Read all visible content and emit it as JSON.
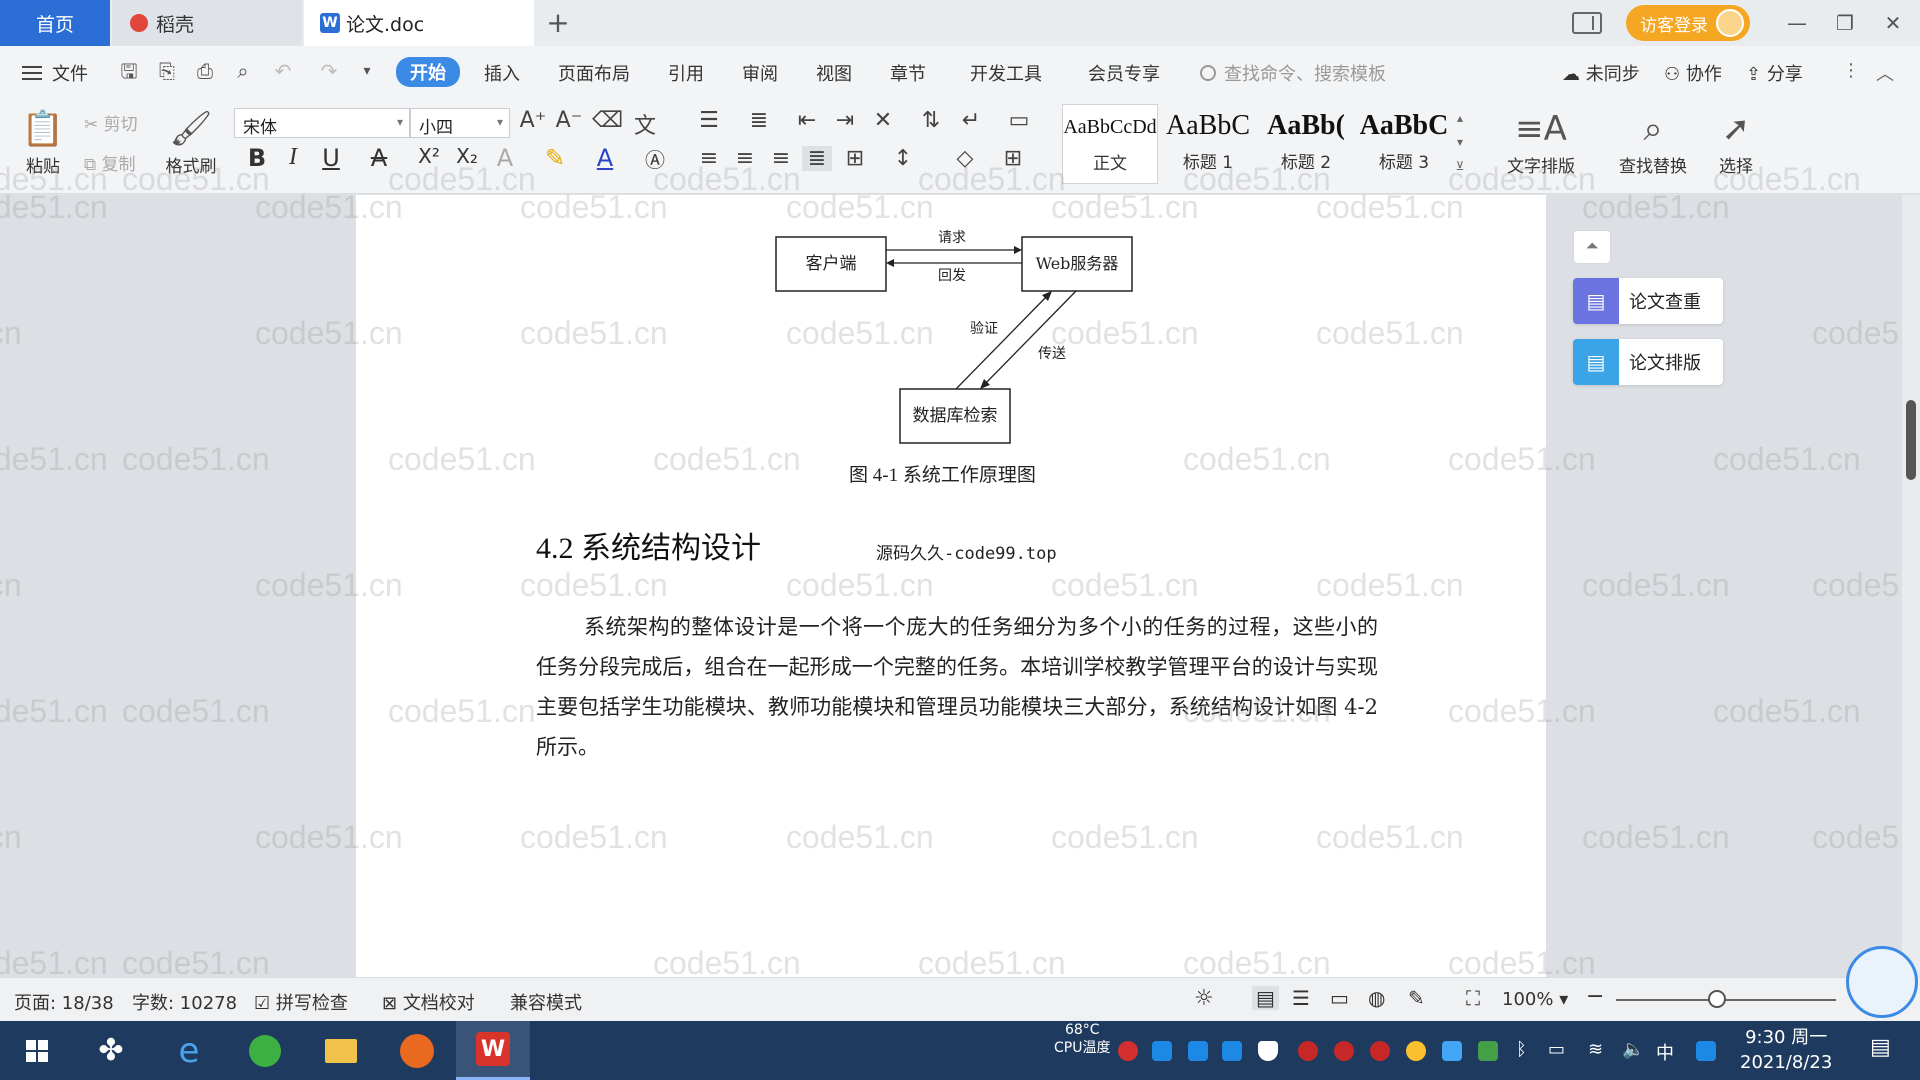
{
  "tabs": {
    "home": "首页",
    "daoke": "稻壳",
    "doc": "论文.doc",
    "add": "+",
    "close": "✕"
  },
  "titlebar": {
    "guest_login": "访客登录"
  },
  "menu": {
    "file": "文件",
    "start": "开始",
    "insert": "插入",
    "page_layout": "页面布局",
    "reference": "引用",
    "review": "审阅",
    "view": "视图",
    "chapter": "章节",
    "dev_tools": "开发工具",
    "member": "会员专享",
    "search_placeholder": "查找命令、搜索模板",
    "unsynced": "未同步",
    "collab": "协作",
    "share": "分享"
  },
  "ribbon": {
    "paste": "粘贴",
    "cut": "剪切",
    "copy": "复制",
    "format_painter": "格式刷",
    "font": "宋体",
    "size": "小四",
    "styles": [
      {
        "preview": "AaBbCcDd",
        "label": "正文"
      },
      {
        "preview": "AaBbC",
        "label": "标题 1"
      },
      {
        "preview": "AaBb(",
        "label": "标题 2"
      },
      {
        "preview": "AaBbC",
        "label": "标题 3"
      }
    ],
    "text_layout": "文字排版",
    "find_replace": "查找替换",
    "select": "选择"
  },
  "document": {
    "diagram": {
      "client": "客户端",
      "server": "Web服务器",
      "db": "数据库检索",
      "request": "请求",
      "reply": "回发",
      "verify": "验证",
      "transfer": "传送"
    },
    "caption": "图 4-1  系统工作原理图",
    "heading": "4.2 系统结构设计",
    "source_tag": "源码久久-code99.top",
    "paragraph": "系统架构的整体设计是一个将一个庞大的任务细分为多个小的任务的过程，这些小的任务分段完成后，组合在一起形成一个完整的任务。本培训学校教学管理平台的设计与实现主要包括学生功能模块、教师功能模块和管理员功能模块三大部分，系统结构设计如图 4-2 所示。",
    "watermark": "code51.cn"
  },
  "side_panel": {
    "check": "论文查重",
    "layout": "论文排版"
  },
  "statusbar": {
    "page": "页面: 18/38",
    "words": "字数: 10278",
    "spellcheck": "拼写检查",
    "proofread": "文档校对",
    "compat": "兼容模式",
    "zoom": "100%"
  },
  "taskbar": {
    "cpu_temp": "68°C",
    "cpu_label": "CPU温度",
    "ime": "中",
    "time": "9:30 周一",
    "date": "2021/8/23"
  },
  "colors": {
    "accent": "#2b6fd6",
    "guest": "#f5a623",
    "taskbar": "#1f3a5f"
  }
}
